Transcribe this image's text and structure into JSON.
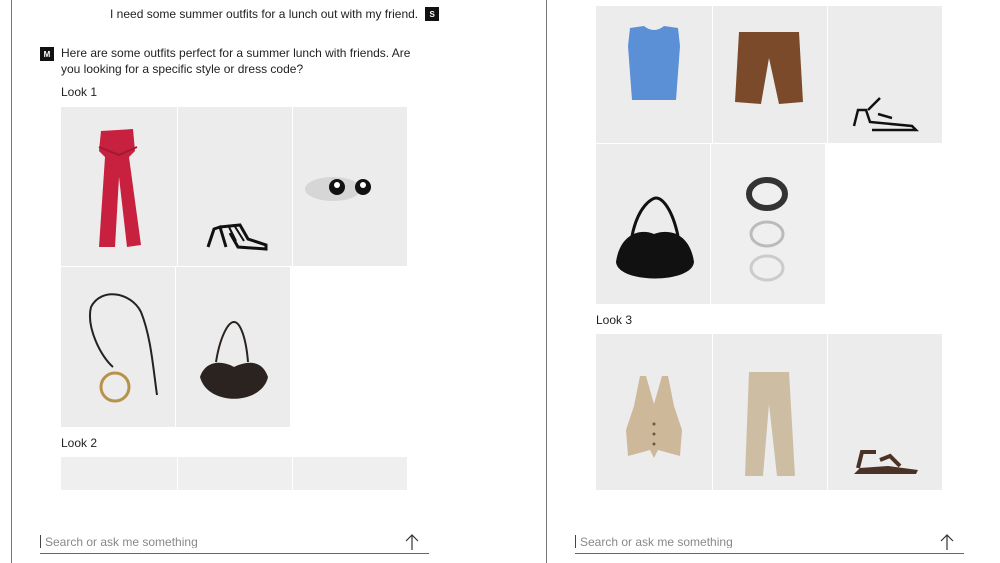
{
  "left": {
    "user_message": "I need some summer outfits for a lunch out with my friend.",
    "user_badge": "S",
    "assistant_badge": "M",
    "assistant_message": "Here are some outfits perfect for a summer lunch with friends. Are you looking for a specific style or dress code?",
    "look1_label": "Look 1",
    "look2_label": "Look 2",
    "search_placeholder": "Search or ask me something"
  },
  "right": {
    "look3_label": "Look 3",
    "search_placeholder": "Search or ask me something"
  },
  "icons": {
    "send": "arrow-up-icon"
  },
  "colors": {
    "red_jumpsuit": "#c8213f",
    "blue_top": "#5b8fd6",
    "brown_shorts": "#7a4a2b",
    "beige": "#cdb89a",
    "dark": "#1a1a1a"
  }
}
